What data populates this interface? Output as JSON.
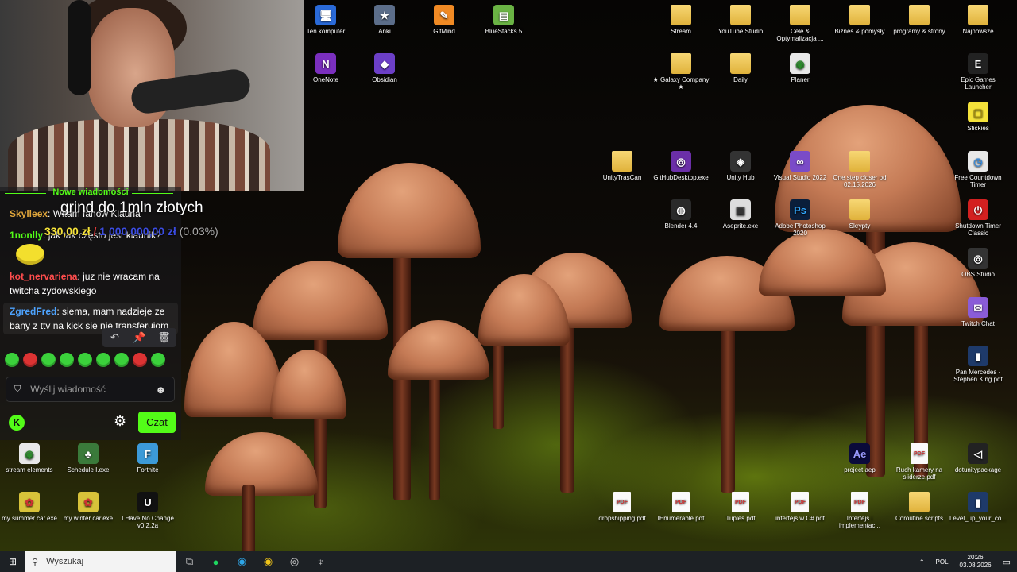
{
  "desktop_icons": [
    {
      "id": "ten-komputer",
      "label": "Ten komputer",
      "icon": "computer-icon"
    },
    {
      "id": "anki",
      "label": "Anki",
      "icon": "anki-icon"
    },
    {
      "id": "gitmind",
      "label": "GitMind",
      "icon": "gitmind-icon"
    },
    {
      "id": "bluestacks",
      "label": "BlueStacks 5",
      "icon": "bluestacks-icon"
    },
    {
      "id": "onenote",
      "label": "OneNote",
      "icon": "onenote-icon"
    },
    {
      "id": "obsidian",
      "label": "Obsidian",
      "icon": "obsidian-icon"
    },
    {
      "id": "stream",
      "label": "Stream",
      "icon": "folder-icon"
    },
    {
      "id": "youtube-studio",
      "label": "YouTube Studio",
      "icon": "folder-icon"
    },
    {
      "id": "cele",
      "label": "Cele & Optymalizacja ...",
      "icon": "folder-icon"
    },
    {
      "id": "biznes",
      "label": "Biznes & pomysły",
      "icon": "folder-icon"
    },
    {
      "id": "programy",
      "label": "programy & strony",
      "icon": "folder-icon"
    },
    {
      "id": "najnowsze",
      "label": "Najnowsze",
      "icon": "folder-icon"
    },
    {
      "id": "galaxy",
      "label": "★ Galaxy Company ★",
      "icon": "folder-icon"
    },
    {
      "id": "daily",
      "label": "Daily",
      "icon": "folder-icon"
    },
    {
      "id": "planer",
      "label": "Planer",
      "icon": "chrome-icon"
    },
    {
      "id": "epic",
      "label": "Epic Games Launcher",
      "icon": "epic-icon"
    },
    {
      "id": "stickies",
      "label": "Stickies",
      "icon": "sticky-note-icon"
    },
    {
      "id": "unitytrascan",
      "label": "UnityTrasCan",
      "icon": "folder-icon"
    },
    {
      "id": "github",
      "label": "GitHubDesktop.exe",
      "icon": "github-icon"
    },
    {
      "id": "unityhub",
      "label": "Unity Hub",
      "icon": "unity-icon"
    },
    {
      "id": "vs2022",
      "label": "Visual Studio 2022",
      "icon": "visual-studio-icon"
    },
    {
      "id": "onestep",
      "label": "One step closer od 02.15.2026",
      "icon": "folder-icon"
    },
    {
      "id": "countdown",
      "label": "Free Countdown Timer",
      "icon": "timer-icon"
    },
    {
      "id": "blender",
      "label": "Blender 4.4",
      "icon": "blender-icon"
    },
    {
      "id": "aseprite",
      "label": "Aseprite.exe",
      "icon": "aseprite-icon"
    },
    {
      "id": "photoshop",
      "label": "Adobe Photoshop 2020",
      "icon": "photoshop-icon"
    },
    {
      "id": "skrypty",
      "label": "Skrypty",
      "icon": "folder-icon"
    },
    {
      "id": "shutdown",
      "label": "Shutdown Timer Classic",
      "icon": "power-icon"
    },
    {
      "id": "obs",
      "label": "OBS Studio",
      "icon": "obs-icon"
    },
    {
      "id": "twitchchat",
      "label": "Twitch Chat",
      "icon": "twitch-chat-icon"
    },
    {
      "id": "panmercedes",
      "label": "Pan Mercedes - Stephen King.pdf",
      "icon": "book-icon"
    },
    {
      "id": "streamelements",
      "label": "stream elements",
      "icon": "chrome-icon"
    },
    {
      "id": "schedule",
      "label": "Schedule I.exe",
      "icon": "schedule-icon"
    },
    {
      "id": "fortnite",
      "label": "Fortnite",
      "icon": "fortnite-icon"
    },
    {
      "id": "project-aep",
      "label": "project.aep",
      "icon": "after-effects-icon"
    },
    {
      "id": "ruch-kamery",
      "label": "Ruch kamery na sliderze.pdf",
      "icon": "pdf-icon"
    },
    {
      "id": "dotunity",
      "label": "dotunitypackage",
      "icon": "unity-package-icon"
    },
    {
      "id": "summer",
      "label": "my summer car.exe",
      "icon": "game-icon"
    },
    {
      "id": "winter",
      "label": "my winter car.exe",
      "icon": "game-icon"
    },
    {
      "id": "ihavenochange",
      "label": "I Have No Change v0.2.2a",
      "icon": "unreal-icon"
    },
    {
      "id": "dropshipping",
      "label": "dropshipping.pdf",
      "icon": "pdf-icon"
    },
    {
      "id": "ienumerable",
      "label": "IEnumerable.pdf",
      "icon": "pdf-icon"
    },
    {
      "id": "tuples",
      "label": "Tuples.pdf",
      "icon": "pdf-icon"
    },
    {
      "id": "interfejs-csharp",
      "label": "interfejs w C#.pdf",
      "icon": "pdf-icon"
    },
    {
      "id": "interfejs-impl",
      "label": "Interfejs i implementac...",
      "icon": "pdf-icon"
    },
    {
      "id": "coroutine",
      "label": "Coroutine scripts",
      "icon": "folder-icon"
    },
    {
      "id": "levelup",
      "label": "Level_up_your_co...",
      "icon": "book-icon"
    }
  ],
  "chat": {
    "header": "Nowe wiadomości",
    "messages": [
      {
        "user": "Skylleex",
        "text": "Witam fanów Klauna",
        "user_color": "#e0a63b"
      },
      {
        "user": "1nonlly",
        "text": "jak tak często jest klaunik?",
        "user_color": "#53fc18"
      },
      {
        "user": "kot_nervariena",
        "text": "juz nie wracam na twitcha zydowskiego",
        "user_color": "#ff4d4d"
      },
      {
        "user": "ZgredFred",
        "text": "siema, mam nadzieje ze bany z ttv na kick sie nie transferujom",
        "user_color": "#4da3ff"
      }
    ],
    "input_placeholder": "Wyślij wiadomość",
    "send_button": "Czat",
    "message_actions": [
      "reply-icon",
      "pin-icon",
      "trash-icon"
    ]
  },
  "goal": {
    "title": "grind do 1mln złotych",
    "current": "330,00 zł",
    "separator": "/",
    "target": "1 000 000,00 zł",
    "percent": "(0.03%)"
  },
  "taskbar": {
    "search_placeholder": "Wyszukaj",
    "language": "POL",
    "time": "20:26",
    "date": "03.08.2026"
  },
  "colors": {
    "kick_green": "#53fc18",
    "goal_yellow": "#f5e23a",
    "goal_red": "#e03b3b",
    "goal_blue": "#3b4ce0"
  }
}
